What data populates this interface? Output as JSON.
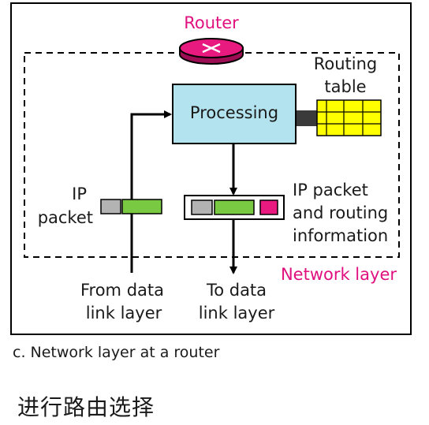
{
  "router": {
    "label": "Router"
  },
  "routing_table": {
    "line1": "Routing",
    "line2": "table"
  },
  "processing": {
    "label": "Processing"
  },
  "ip_packet": {
    "line1": "IP",
    "line2": "packet"
  },
  "ip_packet_routing": {
    "line1": "IP packet",
    "line2": "and routing",
    "line3": "information"
  },
  "network_layer": {
    "label": "Network layer"
  },
  "from_data_link": {
    "line1": "From data",
    "line2": "link layer"
  },
  "to_data_link": {
    "line1": "To data",
    "line2": "link layer"
  },
  "caption": "c. Network layer at a router",
  "footer_text": "进行路由选择",
  "colors": {
    "frame": "#000000",
    "processing_fill": "#b3e3ee",
    "routing_table_fill": "#ffff00",
    "router_fill": "#e8197f",
    "packet_gray": "#b3b3b3",
    "packet_green": "#7ac943",
    "packet_pink": "#e8197f",
    "connector": "#3a3a3a",
    "accent_text": "#e0107f"
  }
}
